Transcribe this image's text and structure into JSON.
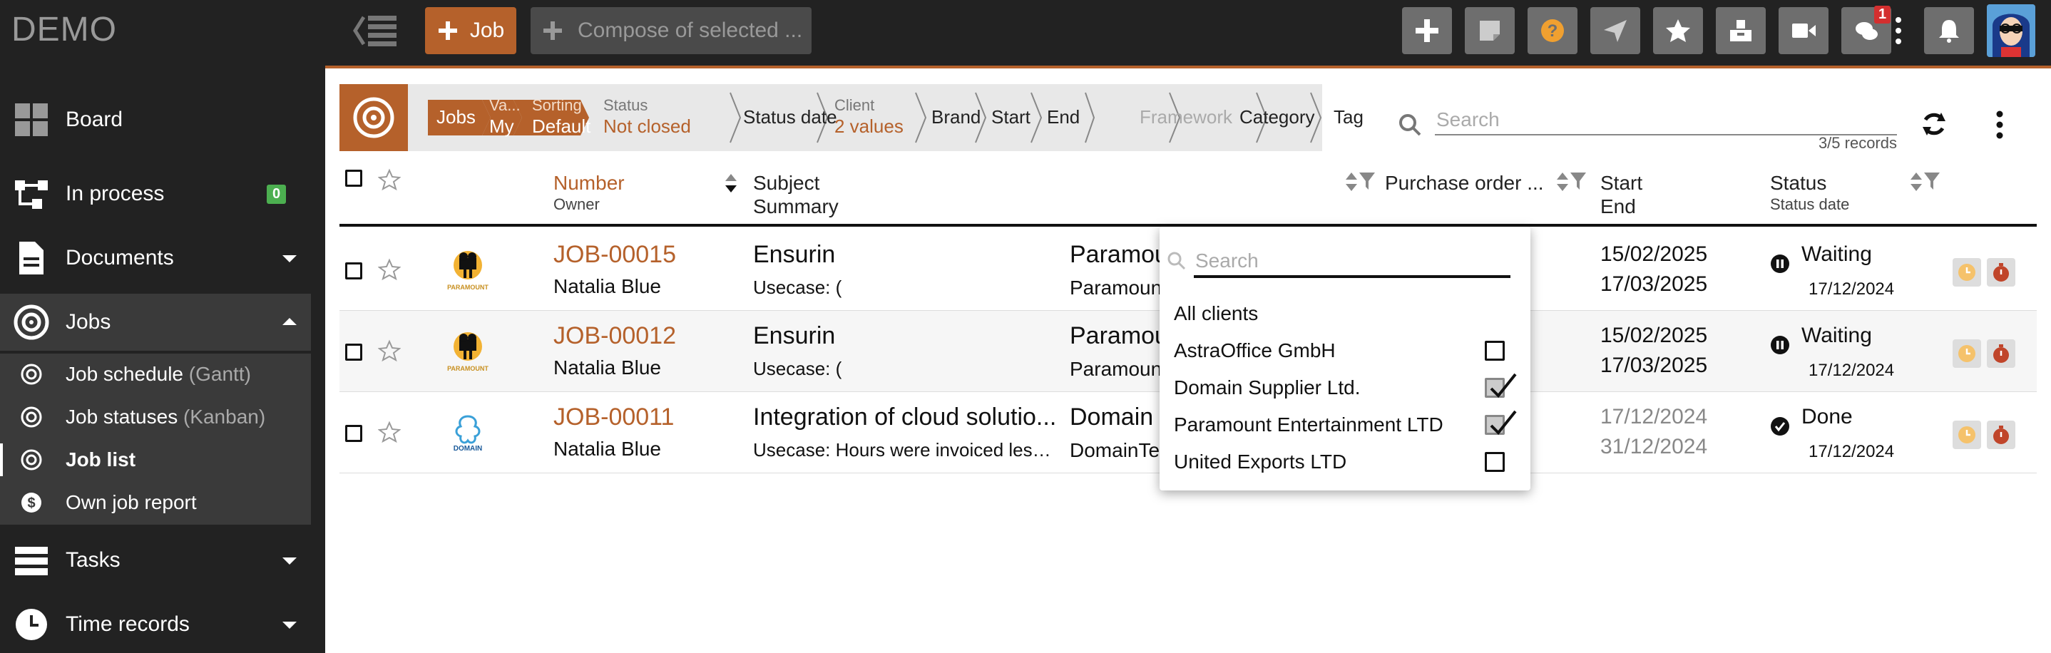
{
  "app": {
    "logo": "DEMO"
  },
  "topbar": {
    "new_job_label": "Job",
    "compose_label": "Compose of selected ...",
    "notification_count": "1",
    "buttons": [
      "add-icon",
      "note-icon",
      "help-icon",
      "send-icon",
      "star-icon",
      "inbox-icon",
      "video-icon",
      "chat-icon",
      "more-vert-icon",
      "bell-icon"
    ]
  },
  "colors": {
    "accent": "#b5612b",
    "sidebar": "#222222",
    "success": "#4caf50",
    "badge": "#d32f2f"
  },
  "sidebar": {
    "items": [
      {
        "label": "Board",
        "icon": "board-icon"
      },
      {
        "label": "In process",
        "icon": "process-icon",
        "count": "0"
      },
      {
        "label": "Documents",
        "icon": "document-icon"
      },
      {
        "label": "Jobs",
        "icon": "target-icon"
      },
      {
        "label": "Tasks",
        "icon": "tasks-icon"
      },
      {
        "label": "Time records",
        "icon": "clock-icon"
      }
    ],
    "jobs_sub": [
      {
        "label": "Job schedule",
        "hint": "(Gantt)"
      },
      {
        "label": "Job statuses",
        "hint": "(Kanban)"
      },
      {
        "label": "Job list",
        "hint": ""
      },
      {
        "label": "Own job report",
        "hint": ""
      }
    ]
  },
  "filters": {
    "jobs": "Jobs",
    "variant_top": "Va...",
    "variant_val": "My",
    "sorting_top": "Sorting",
    "sorting_val": "Default",
    "status_top": "Status",
    "status_val": "Not closed",
    "status_date": "Status date",
    "client_top": "Client",
    "client_val": "2 values",
    "brand": "Brand",
    "start": "Start",
    "end": "End",
    "framework": "Framework",
    "category": "Category",
    "tag": "Tag",
    "search_placeholder": "Search",
    "records": "3/5 records"
  },
  "table": {
    "headers": {
      "number": "Number",
      "owner": "Owner",
      "subject": "Subject",
      "summary": "Summary",
      "purchase_order": "Purchase order ...",
      "start": "Start",
      "end": "End",
      "status": "Status",
      "status_date": "Status date"
    },
    "rows": [
      {
        "number": "JOB-00015",
        "owner": "Natalia Blue",
        "subject": "Ensurin",
        "summary": "Usecase: (",
        "client": "Paramount Entertainment ...",
        "brand": "Paramount Entertainment",
        "start": "15/02/2025",
        "end": "17/03/2025",
        "status": "Waiting",
        "status_date": "17/12/2024",
        "logo": "PARAMOUNT"
      },
      {
        "number": "JOB-00012",
        "owner": "Natalia Blue",
        "subject": "Ensurin",
        "summary": "Usecase: (",
        "client": "Paramount Entertainment ...",
        "brand": "Paramount Entertainment",
        "start": "15/02/2025",
        "end": "17/03/2025",
        "status": "Waiting",
        "status_date": "17/12/2024",
        "logo": "PARAMOUNT"
      },
      {
        "number": "JOB-00011",
        "owner": "Natalia Blue",
        "subject": "Integration of cloud solutio...",
        "summary": "Usecase: Hours were invoiced less t...",
        "client": "Domain Supplier Ltd.",
        "brand": "DomainTechnology",
        "start": "17/12/2024",
        "end": "31/12/2024",
        "status": "Done",
        "status_date": "17/12/2024",
        "logo": "DOMAIN"
      }
    ]
  },
  "client_dropdown": {
    "search_placeholder": "Search",
    "all_label": "All clients",
    "options": [
      {
        "label": "AstraOffice GmbH",
        "checked": false
      },
      {
        "label": "Domain Supplier Ltd.",
        "checked": true
      },
      {
        "label": "Paramount Entertainment LTD",
        "checked": true
      },
      {
        "label": "United Exports LTD",
        "checked": false
      }
    ]
  }
}
